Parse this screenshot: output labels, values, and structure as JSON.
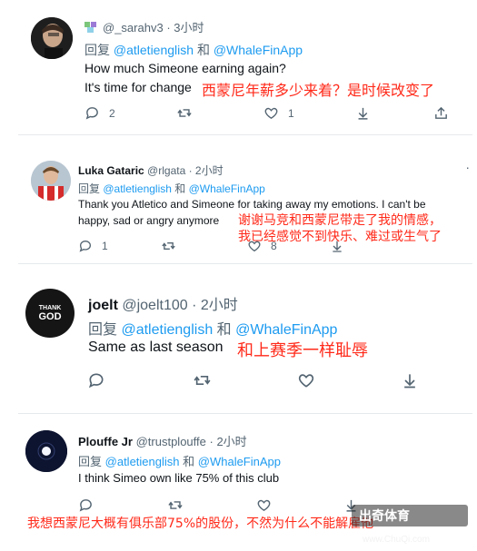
{
  "tweets": [
    {
      "username": "@_sarahv3",
      "time": "· 3小时",
      "reply_prefix": "回复",
      "reply_mention1": "@atletienglish",
      "reply_and": "和",
      "reply_mention2": "@WhaleFinApp",
      "line1": "How much Simeone earning again?",
      "line2": "It's time for change",
      "translation": "西蒙尼年薪多少来着？是时候改变了",
      "reply_count": "2",
      "like_count": "1"
    },
    {
      "display_name": "Luka Gataric",
      "username": "@rlgata",
      "time": "· 2小时",
      "reply_prefix": "回复",
      "reply_mention1": "@atletienglish",
      "reply_and": "和",
      "reply_mention2": "@WhaleFinApp",
      "line1": "Thank you Atletico and Simeone for taking away my emotions. I can't be",
      "line2": "happy, sad or angry anymore",
      "translation1": "谢谢马竞和西蒙尼带走了我的情感，",
      "translation2": "我已经感觉不到快乐、难过或生气了",
      "reply_count": "1",
      "like_count": "8",
      "more": "·"
    },
    {
      "display_name": "joelt",
      "username": "@joelt100",
      "time": "· 2小时",
      "avatar_text1": "THANK",
      "avatar_text2": "GOD",
      "reply_prefix": "回复",
      "reply_mention1": "@atletienglish",
      "reply_and": "和",
      "reply_mention2": "@WhaleFinApp",
      "line1": "Same as last season",
      "translation": "和上赛季一样耻辱"
    },
    {
      "display_name": "Plouffe Jr",
      "username": "@trustplouffe",
      "time": "· 2小时",
      "reply_prefix": "回复",
      "reply_mention1": "@atletienglish",
      "reply_and": "和",
      "reply_mention2": "@WhaleFinApp",
      "line1": "I think Simeo own like 75% of this club",
      "translation": "我想西蒙尼大概有俱乐部75%的股份，不然为什么不能解雇他"
    }
  ],
  "watermark": {
    "text": "出奇体育",
    "url": "www.ChuQi.com"
  },
  "colors": {
    "mention": "#1d9bf0",
    "annotation": "#ff2a1a",
    "muted": "#536471"
  }
}
